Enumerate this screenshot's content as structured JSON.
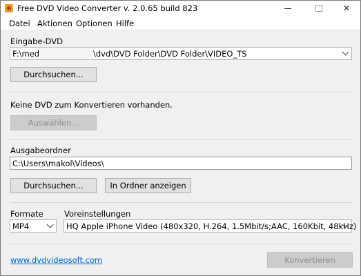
{
  "window": {
    "title": "Free DVD Video Converter  v. 2.0.65 build 823",
    "controls": {
      "minimize": "minimize",
      "maximize": "maximize",
      "close": "✕"
    }
  },
  "menu": [
    "Datei",
    "Aktionen",
    "Optionen",
    "Hilfe"
  ],
  "input_dvd": {
    "label": "Eingabe-DVD",
    "path_prefix": "F:\\media",
    "path_suffix": "\\dvd\\DVD Folder\\DVD Folder\\VIDEO_TS",
    "browse_button": "Durchsuchen..."
  },
  "dvd_status": {
    "message": "Keine DVD zum Konvertieren vorhanden.",
    "select_button": "Auswählen..."
  },
  "output": {
    "label": "Ausgabeordner",
    "path": "C:\\Users\\makol\\Videos\\",
    "browse_button": "Durchsuchen...",
    "show_in_folder_button": "In Ordner anzeigen"
  },
  "format": {
    "label": "Formate",
    "selected": "MP4"
  },
  "preset": {
    "label": "Voreinstellungen",
    "selected": "HQ Apple iPhone Video (480x320, H.264, 1.5Mbit/s;AAC, 160Kbit, 48kHz)"
  },
  "footer": {
    "website_link": "www.dvdvideosoft.com",
    "convert_button": "Konvertieren"
  }
}
